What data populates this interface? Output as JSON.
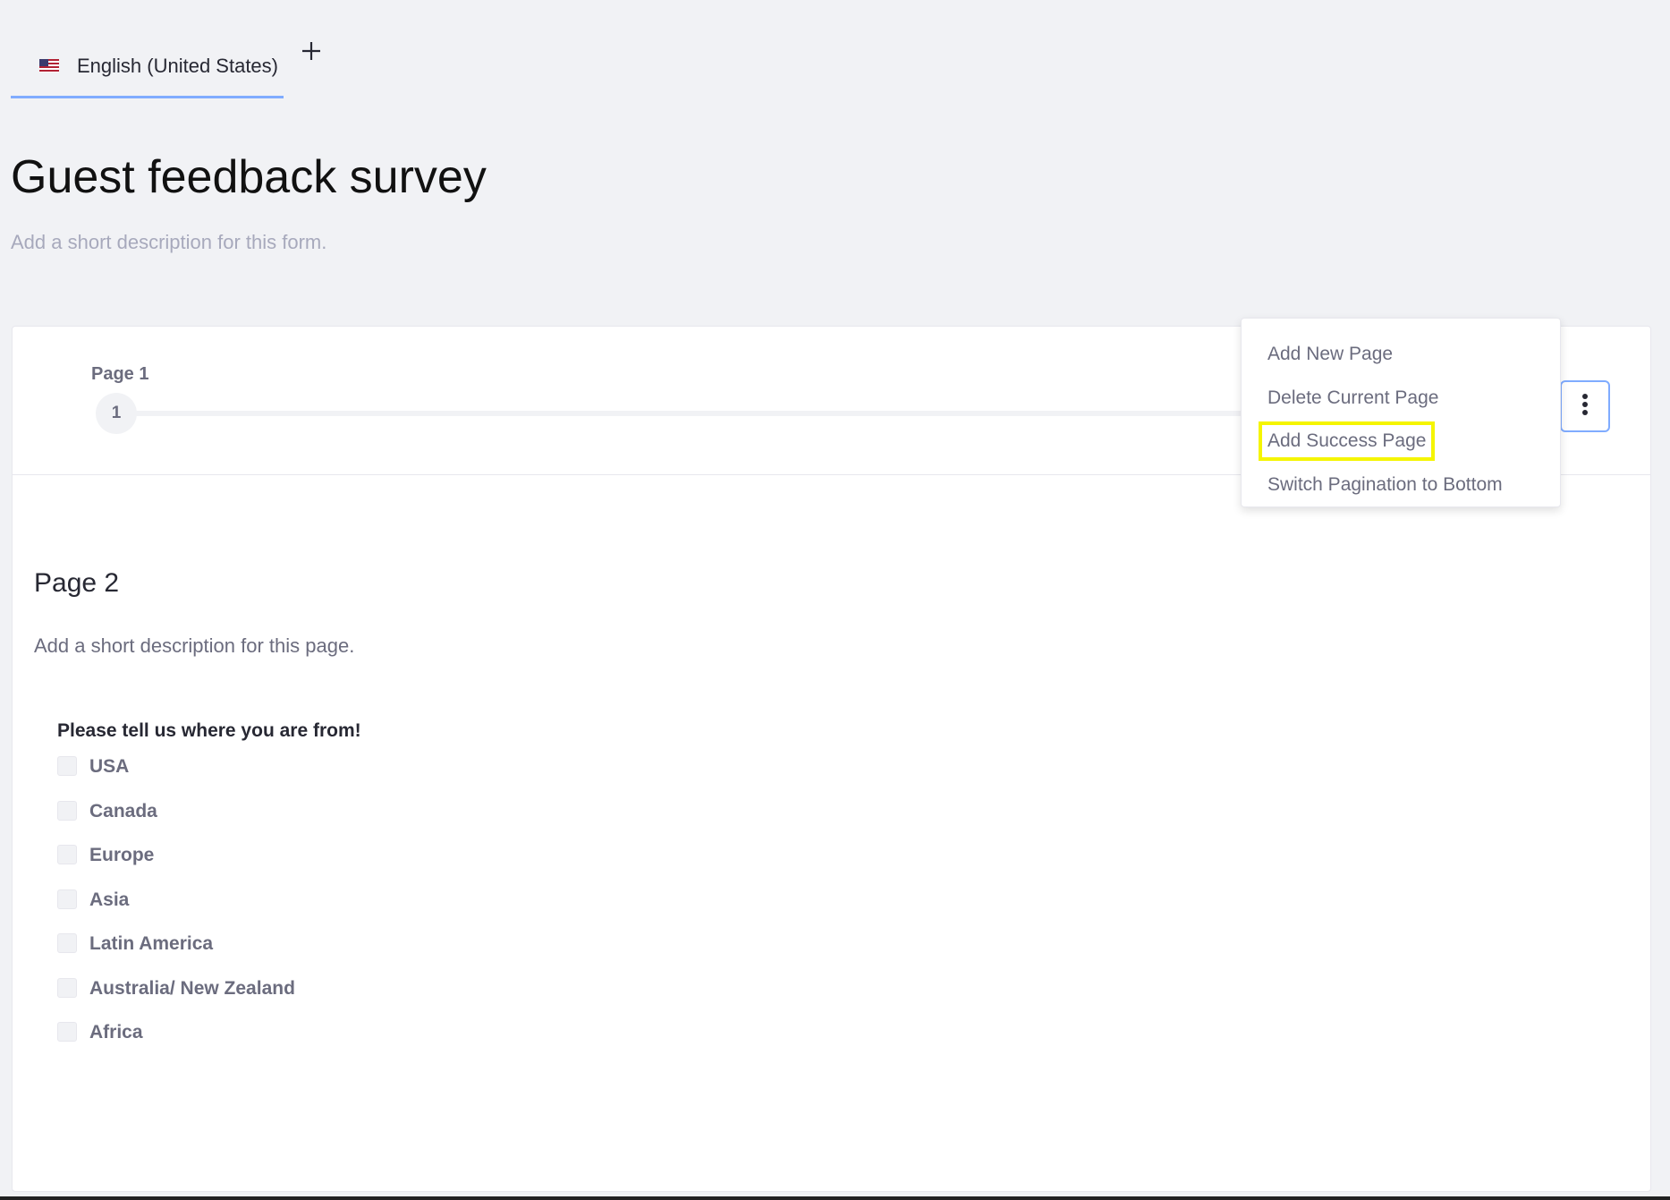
{
  "language_bar": {
    "active_language": "English (United States)",
    "add_language_icon": "plus-icon",
    "flag_icon": "us-flag-icon",
    "accent_color": "#80acff"
  },
  "form": {
    "title": "Guest feedback survey",
    "description_placeholder": "Add a short description for this form."
  },
  "pagination": {
    "current_page_label": "Page 1",
    "current_page_number": "1",
    "menu_icon": "vertical-ellipsis-icon"
  },
  "dropdown_menu": {
    "items": [
      {
        "label": "Add New Page"
      },
      {
        "label": "Delete Current Page"
      },
      {
        "label": "Add Success Page",
        "highlighted": true
      },
      {
        "label": "Switch Pagination to Bottom"
      }
    ],
    "highlight_color": "#f5f500"
  },
  "page": {
    "title": "Page 2",
    "description_placeholder": "Add a short description for this page."
  },
  "question": {
    "label": "Please tell us where you are from!",
    "options": [
      {
        "label": "USA",
        "checked": false
      },
      {
        "label": "Canada",
        "checked": false
      },
      {
        "label": "Europe",
        "checked": false
      },
      {
        "label": "Asia",
        "checked": false
      },
      {
        "label": "Latin America",
        "checked": false
      },
      {
        "label": "Australia/ New Zealand",
        "checked": false
      },
      {
        "label": "Africa",
        "checked": false
      }
    ]
  }
}
